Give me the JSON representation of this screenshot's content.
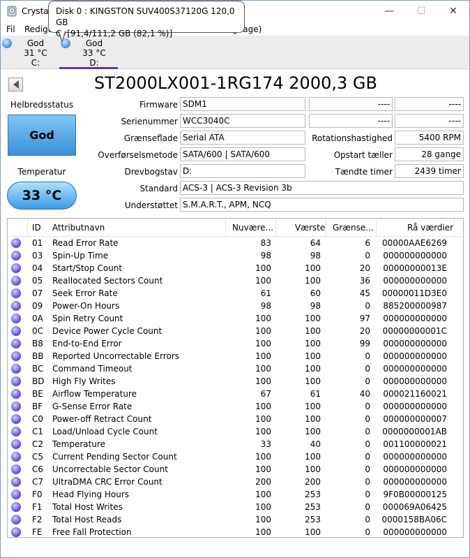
{
  "window": {
    "title": "Crystall",
    "controls": {
      "minimize": "—",
      "maximize": "☐",
      "close": "✕"
    }
  },
  "menu": {
    "items": [
      "Fil",
      "Redige",
      "guage)"
    ]
  },
  "tooltip": {
    "line1": "Disk 0 : KINGSTON SUV400S37120G 120,0 GB",
    "line2": "C:  [91,4/111,2 GB (82,1 %)]"
  },
  "drives": [
    {
      "status": "God",
      "temp": "31 °C",
      "letter": "C:"
    },
    {
      "status": "God",
      "temp": "33 °C",
      "letter": "D:"
    }
  ],
  "header": {
    "model": "ST2000LX001-1RG174 2000,3 GB"
  },
  "left": {
    "health_label": "Helbredsstatus",
    "health_value": "God",
    "temp_label": "Temperatur",
    "temp_value": "33 °C"
  },
  "info": {
    "firmware_label": "Firmware",
    "firmware": "SDM1",
    "serial_label": "Serienummer",
    "serial": "WCC3040C",
    "interface_label": "Grænseflade",
    "interface": "Serial ATA",
    "transfer_label": "Overførselsmetode",
    "transfer": "SATA/600 | SATA/600",
    "drive_letter_label": "Drevbogstav",
    "drive_letter": "D:",
    "standard_label": "Standard",
    "standard": "ACS-3 | ACS-3 Revision 3b",
    "features_label": "Understøttet",
    "features": "S.M.A.R.T., APM, NCQ",
    "r1_label": "----",
    "r1_value": "----",
    "r2_label": "----",
    "r2_value": "----",
    "rotation_label": "Rotationshastighed",
    "rotation": "5400 RPM",
    "power_count_label": "Opstart tæller",
    "power_count": "28 gange",
    "power_hours_label": "Tændte timer",
    "power_hours": "2439 timer"
  },
  "table": {
    "headers": {
      "id": "ID",
      "name": "Attributnavn",
      "current": "Nuvære...",
      "worst": "Værste",
      "threshold": "Grænse...",
      "raw": "Rå værdier"
    },
    "rows": [
      {
        "id": "01",
        "name": "Read Error Rate",
        "current": "83",
        "worst": "64",
        "threshold": "6",
        "raw": "00000AAE6269"
      },
      {
        "id": "03",
        "name": "Spin-Up Time",
        "current": "98",
        "worst": "98",
        "threshold": "0",
        "raw": "000000000000"
      },
      {
        "id": "04",
        "name": "Start/Stop Count",
        "current": "100",
        "worst": "100",
        "threshold": "20",
        "raw": "00000000013E"
      },
      {
        "id": "05",
        "name": "Reallocated Sectors Count",
        "current": "100",
        "worst": "100",
        "threshold": "36",
        "raw": "000000000000"
      },
      {
        "id": "07",
        "name": "Seek Error Rate",
        "current": "61",
        "worst": "60",
        "threshold": "45",
        "raw": "00000011D3E0"
      },
      {
        "id": "09",
        "name": "Power-On Hours",
        "current": "98",
        "worst": "98",
        "threshold": "0",
        "raw": "885200000987"
      },
      {
        "id": "0A",
        "name": "Spin Retry Count",
        "current": "100",
        "worst": "100",
        "threshold": "97",
        "raw": "000000000000"
      },
      {
        "id": "0C",
        "name": "Device Power Cycle Count",
        "current": "100",
        "worst": "100",
        "threshold": "20",
        "raw": "00000000001C"
      },
      {
        "id": "B8",
        "name": "End-to-End Error",
        "current": "100",
        "worst": "100",
        "threshold": "99",
        "raw": "000000000000"
      },
      {
        "id": "BB",
        "name": "Reported Uncorrectable Errors",
        "current": "100",
        "worst": "100",
        "threshold": "0",
        "raw": "000000000000"
      },
      {
        "id": "BC",
        "name": "Command Timeout",
        "current": "100",
        "worst": "100",
        "threshold": "0",
        "raw": "000000000000"
      },
      {
        "id": "BD",
        "name": "High Fly Writes",
        "current": "100",
        "worst": "100",
        "threshold": "0",
        "raw": "000000000000"
      },
      {
        "id": "BE",
        "name": "Airflow Temperature",
        "current": "67",
        "worst": "61",
        "threshold": "40",
        "raw": "000021160021"
      },
      {
        "id": "BF",
        "name": "G-Sense Error Rate",
        "current": "100",
        "worst": "100",
        "threshold": "0",
        "raw": "000000000000"
      },
      {
        "id": "C0",
        "name": "Power-off Retract Count",
        "current": "100",
        "worst": "100",
        "threshold": "0",
        "raw": "000000000007"
      },
      {
        "id": "C1",
        "name": "Load/Unload Cycle Count",
        "current": "100",
        "worst": "100",
        "threshold": "0",
        "raw": "0000000001AB"
      },
      {
        "id": "C2",
        "name": "Temperature",
        "current": "33",
        "worst": "40",
        "threshold": "0",
        "raw": "001100000021"
      },
      {
        "id": "C5",
        "name": "Current Pending Sector Count",
        "current": "100",
        "worst": "100",
        "threshold": "0",
        "raw": "000000000000"
      },
      {
        "id": "C6",
        "name": "Uncorrectable Sector Count",
        "current": "100",
        "worst": "100",
        "threshold": "0",
        "raw": "000000000000"
      },
      {
        "id": "C7",
        "name": "UltraDMA CRC Error Count",
        "current": "200",
        "worst": "200",
        "threshold": "0",
        "raw": "000000000000"
      },
      {
        "id": "F0",
        "name": "Head Flying Hours",
        "current": "100",
        "worst": "253",
        "threshold": "0",
        "raw": "9F0B00000125"
      },
      {
        "id": "F1",
        "name": "Total Host Writes",
        "current": "100",
        "worst": "253",
        "threshold": "0",
        "raw": "000069A06425"
      },
      {
        "id": "F2",
        "name": "Total Host Reads",
        "current": "100",
        "worst": "253",
        "threshold": "0",
        "raw": "0000158BA06C"
      },
      {
        "id": "FE",
        "name": "Free Fall Protection",
        "current": "100",
        "worst": "100",
        "threshold": "0",
        "raw": "000000000000"
      }
    ]
  },
  "colors": {
    "health_good": "#5aaae8",
    "status_dot": "#5a4fe0",
    "drive_dot": "#3d8fe0",
    "selected_drive_underline": "#6a2fb8"
  }
}
